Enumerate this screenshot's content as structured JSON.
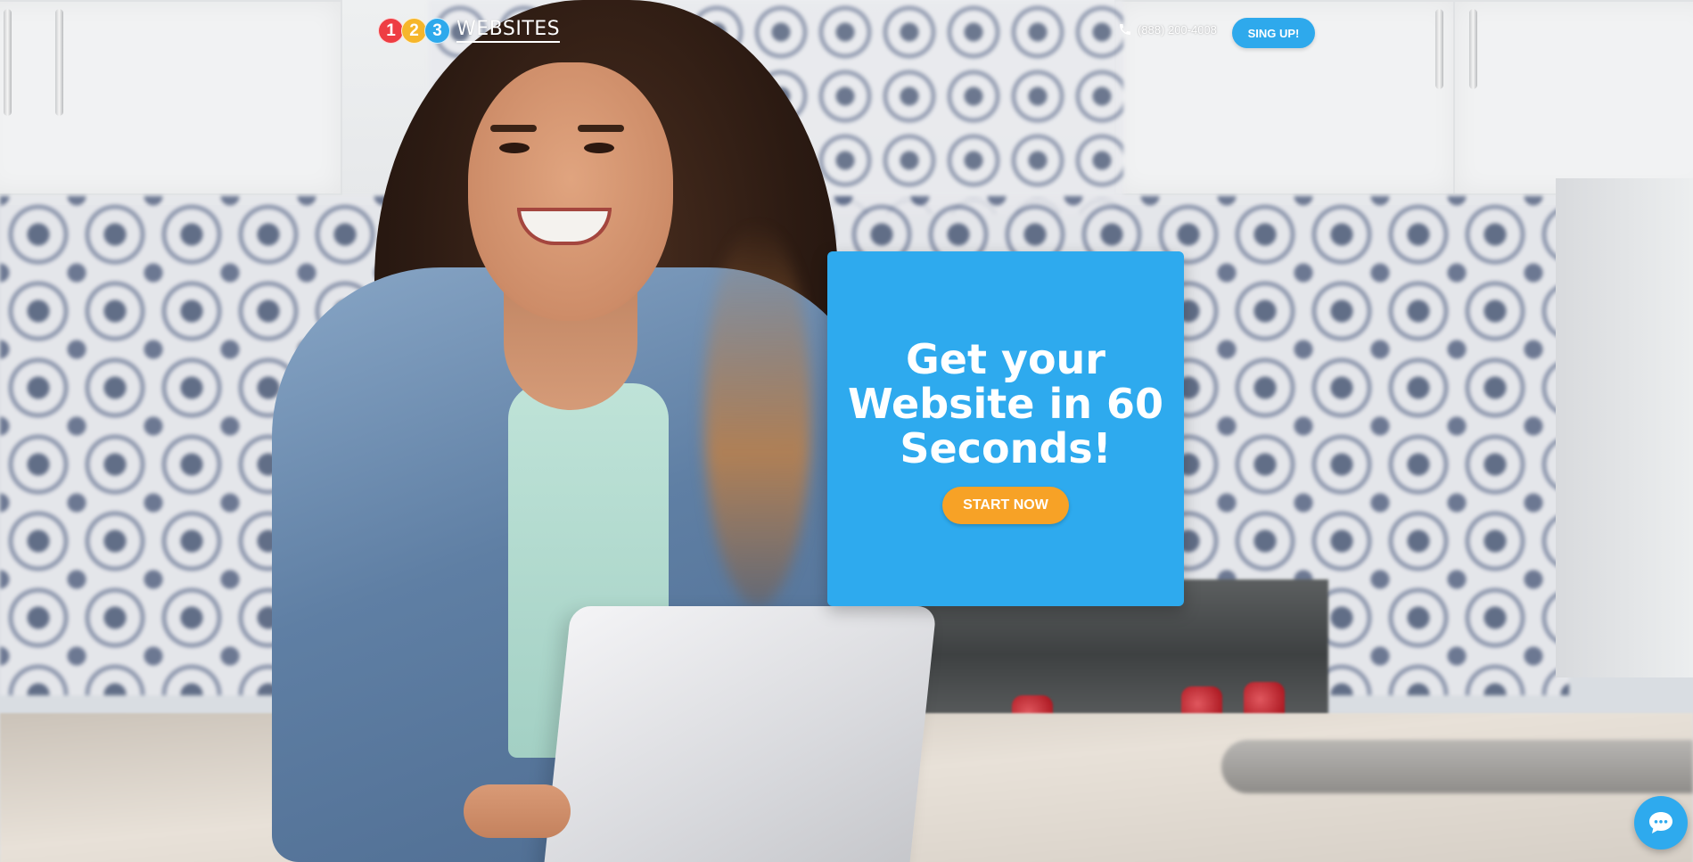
{
  "header": {
    "logo": {
      "numbers": [
        {
          "text": "1",
          "color": "#ee3d43"
        },
        {
          "text": "2",
          "color": "#f6b62b"
        },
        {
          "text": "3",
          "color": "#2ea9ec"
        }
      ],
      "word": "WEBSITES"
    },
    "phone": {
      "icon": "phone-icon",
      "number": "(888) 200-4008"
    },
    "signup_label": "SING UP!"
  },
  "hero": {
    "title": "Get your\nWebsite  in 60\nSeconds!",
    "cta_label": "START NOW",
    "card_color": "#2eaaee",
    "cta_color": "#f7a226"
  },
  "chat": {
    "icon": "chat-bubble-icon",
    "color": "#2eaaee"
  }
}
